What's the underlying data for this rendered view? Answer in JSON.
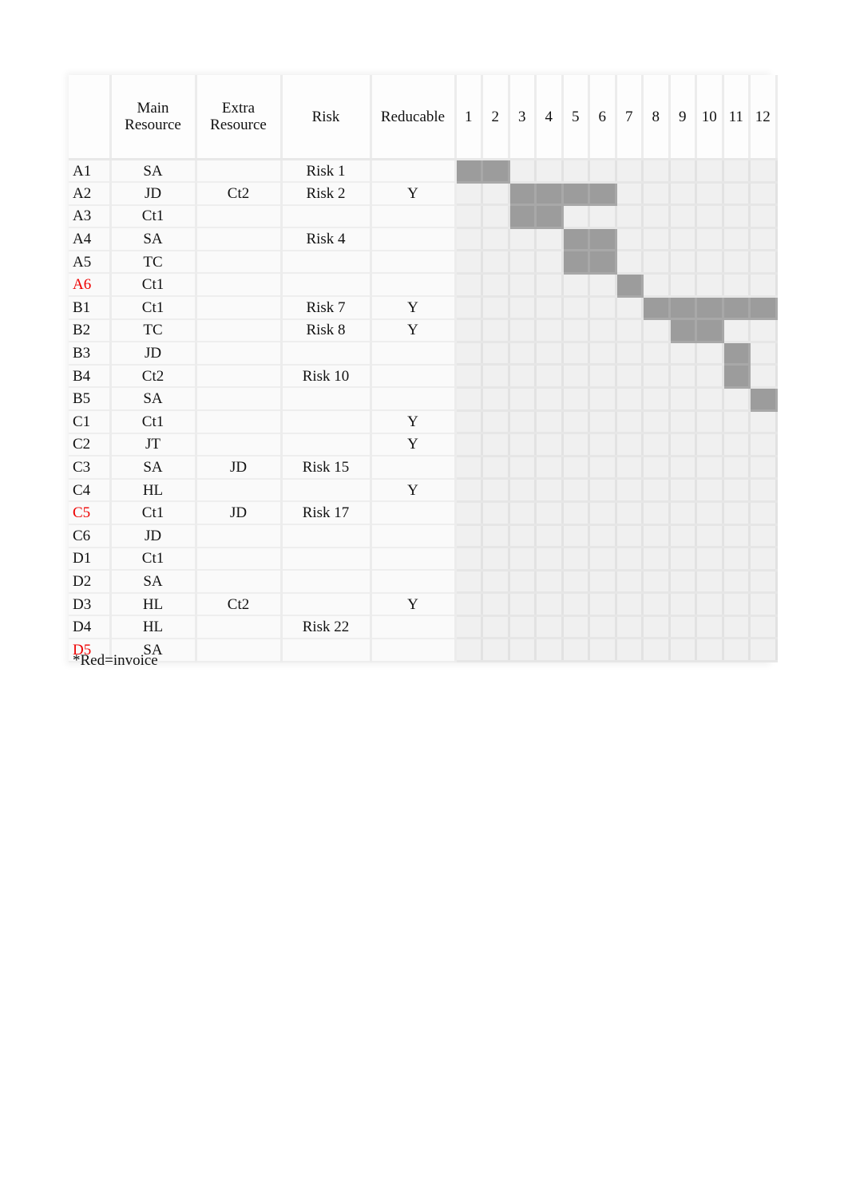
{
  "table": {
    "headers": {
      "task": "",
      "main_resource": "Main\nResource",
      "extra_resource": "Extra\nResource",
      "risk": "Risk",
      "reducable": "Reducable",
      "weeks": [
        "1",
        "2",
        "3",
        "4",
        "5",
        "6",
        "7",
        "8",
        "9",
        "10",
        "11",
        "12"
      ]
    },
    "rows": [
      {
        "task": "A1",
        "main": "SA",
        "extra": "",
        "risk": "Risk 1",
        "reducable": "",
        "invoice": false,
        "weeks": [
          1,
          2
        ]
      },
      {
        "task": "A2",
        "main": "JD",
        "extra": "Ct2",
        "risk": "Risk 2",
        "reducable": "Y",
        "invoice": false,
        "weeks": [
          3,
          4,
          5,
          6
        ]
      },
      {
        "task": "A3",
        "main": "Ct1",
        "extra": "",
        "risk": "",
        "reducable": "",
        "invoice": false,
        "weeks": [
          3,
          4
        ]
      },
      {
        "task": "A4",
        "main": "SA",
        "extra": "",
        "risk": "Risk 4",
        "reducable": "",
        "invoice": false,
        "weeks": [
          5,
          6
        ]
      },
      {
        "task": "A5",
        "main": "TC",
        "extra": "",
        "risk": "",
        "reducable": "",
        "invoice": false,
        "weeks": [
          5,
          6
        ]
      },
      {
        "task": "A6",
        "main": "Ct1",
        "extra": "",
        "risk": "",
        "reducable": "",
        "invoice": true,
        "weeks": [
          7
        ]
      },
      {
        "task": "B1",
        "main": "Ct1",
        "extra": "",
        "risk": "Risk 7",
        "reducable": "Y",
        "invoice": false,
        "weeks": [
          8,
          9,
          10,
          11,
          12
        ]
      },
      {
        "task": "B2",
        "main": "TC",
        "extra": "",
        "risk": "Risk 8",
        "reducable": "Y",
        "invoice": false,
        "weeks": [
          9,
          10
        ]
      },
      {
        "task": "B3",
        "main": "JD",
        "extra": "",
        "risk": "",
        "reducable": "",
        "invoice": false,
        "weeks": [
          11
        ]
      },
      {
        "task": "B4",
        "main": "Ct2",
        "extra": "",
        "risk": "Risk 10",
        "reducable": "",
        "invoice": false,
        "weeks": [
          11
        ]
      },
      {
        "task": "B5",
        "main": "SA",
        "extra": "",
        "risk": "",
        "reducable": "",
        "invoice": false,
        "weeks": [
          12
        ]
      },
      {
        "task": "C1",
        "main": "Ct1",
        "extra": "",
        "risk": "",
        "reducable": "Y",
        "invoice": false,
        "weeks": []
      },
      {
        "task": "C2",
        "main": "JT",
        "extra": "",
        "risk": "",
        "reducable": "Y",
        "invoice": false,
        "weeks": []
      },
      {
        "task": "C3",
        "main": "SA",
        "extra": "JD",
        "risk": "Risk 15",
        "reducable": "",
        "invoice": false,
        "weeks": []
      },
      {
        "task": "C4",
        "main": "HL",
        "extra": "",
        "risk": "",
        "reducable": "Y",
        "invoice": false,
        "weeks": []
      },
      {
        "task": "C5",
        "main": "Ct1",
        "extra": "JD",
        "risk": "Risk 17",
        "reducable": "",
        "invoice": true,
        "weeks": []
      },
      {
        "task": "C6",
        "main": "JD",
        "extra": "",
        "risk": "",
        "reducable": "",
        "invoice": false,
        "weeks": []
      },
      {
        "task": "D1",
        "main": "Ct1",
        "extra": "",
        "risk": "",
        "reducable": "",
        "invoice": false,
        "weeks": []
      },
      {
        "task": "D2",
        "main": "SA",
        "extra": "",
        "risk": "",
        "reducable": "",
        "invoice": false,
        "weeks": []
      },
      {
        "task": "D3",
        "main": "HL",
        "extra": "Ct2",
        "risk": "",
        "reducable": "Y",
        "invoice": false,
        "weeks": []
      },
      {
        "task": "D4",
        "main": "HL",
        "extra": "",
        "risk": "Risk 22",
        "reducable": "",
        "invoice": false,
        "weeks": []
      },
      {
        "task": "D5",
        "main": "SA",
        "extra": "",
        "risk": "",
        "reducable": "",
        "invoice": true,
        "weeks": []
      }
    ]
  },
  "note": "*Red=invoice",
  "colors": {
    "invoice_text": "#ee0000",
    "bar_fill": "#9c9c9c",
    "grid_cell": "#f0f0f0"
  }
}
